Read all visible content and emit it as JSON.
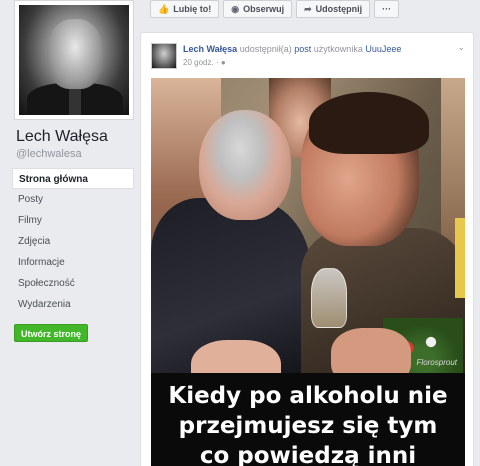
{
  "profile": {
    "name": "Lech Wałęsa",
    "handle": "@lechwalesa"
  },
  "nav": {
    "items": [
      {
        "label": "Strona główna",
        "active": true
      },
      {
        "label": "Posty"
      },
      {
        "label": "Filmy"
      },
      {
        "label": "Zdjęcia"
      },
      {
        "label": "Informacje"
      },
      {
        "label": "Społeczność"
      },
      {
        "label": "Wydarzenia"
      }
    ],
    "create_page_label": "Utwórz stronę"
  },
  "actions": {
    "like": {
      "label": "Lubię to!",
      "icon": "thumbs-up-icon"
    },
    "follow": {
      "label": "Obserwuj",
      "icon": "rss-icon"
    },
    "share": {
      "label": "Udostępnij",
      "icon": "share-arrow-icon"
    },
    "more": {
      "label": "···",
      "icon": "ellipsis-icon"
    }
  },
  "post": {
    "author": "Lech Wałęsa",
    "verb": "udostępnił(a)",
    "link_post": "post",
    "of_user": "użytkownika",
    "original_user": "UuuJeee",
    "time": "20 godz.",
    "audience_icon": "globe-icon",
    "watermark": "Florosprout",
    "caption_lines": [
      "Kiedy po alkoholu nie",
      "przejmujesz się tym",
      "co powiedzą inni"
    ]
  },
  "colors": {
    "link": "#365899",
    "create_button": "#42b72a",
    "background": "#e9ebee"
  }
}
